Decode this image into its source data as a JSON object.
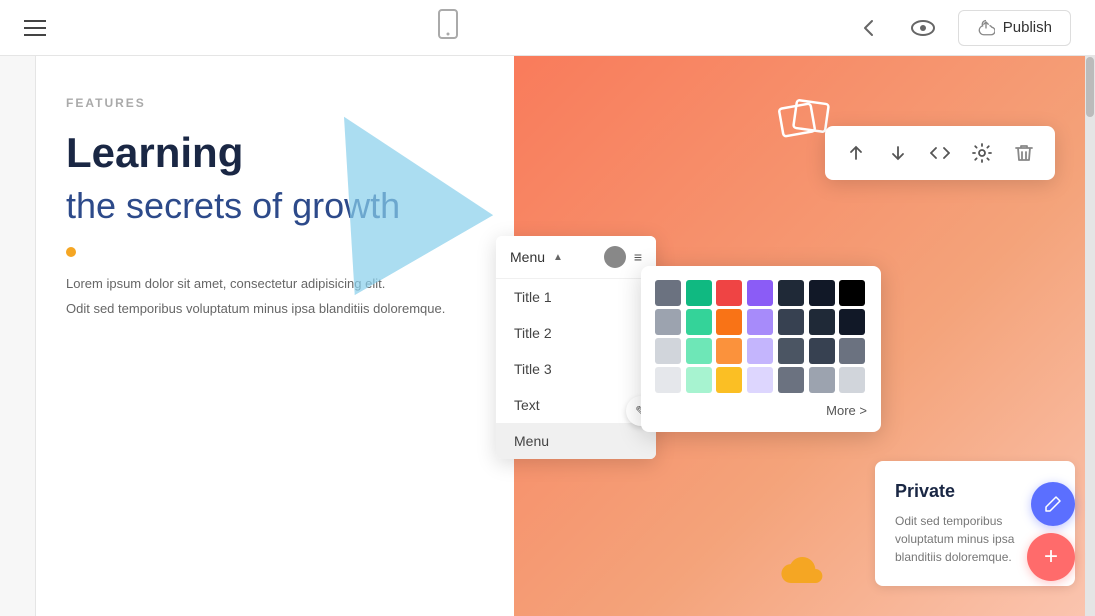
{
  "topbar": {
    "menu_label": "Menu",
    "back_label": "←",
    "eye_label": "👁",
    "publish_label": "Publish",
    "upload_icon": "⬆"
  },
  "toolbar": {
    "move_up": "↑",
    "move_down": "↓",
    "code": "</>",
    "settings": "⚙",
    "delete": "🗑"
  },
  "dropdown": {
    "menu_label": "Menu",
    "chevron": "▲",
    "items": [
      {
        "label": "Title 1"
      },
      {
        "label": "Title 2"
      },
      {
        "label": "Title 3"
      },
      {
        "label": "Text"
      },
      {
        "label": "Menu"
      }
    ]
  },
  "color_picker": {
    "colors": [
      "#6b7280",
      "#10b981",
      "#ef4444",
      "#8b5cf6",
      "#1f2937",
      "#111827",
      "#000000",
      "#9ca3af",
      "#34d399",
      "#f97316",
      "#a78bfa",
      "#374151",
      "#1f2937",
      "#111827",
      "#d1d5db",
      "#6ee7b7",
      "#fb923c",
      "#c4b5fd",
      "#4b5563",
      "#374151",
      "#6b7280",
      "#e5e7eb",
      "#a7f3d0",
      "#fbbf24",
      "#ddd6fe",
      "#6b7280",
      "#9ca3af",
      "#d1d5db"
    ],
    "more_label": "More >"
  },
  "page": {
    "features_label": "FEATURES",
    "headline": "Learning",
    "subheadline": "the secrets of growth",
    "orange_dot": true,
    "body_text_1": "Lorem ipsum dolor sit amet, consectetur adipisicing elit.",
    "body_text_2": "Odit sed temporibus voluptatum minus ipsa blanditiis doloremque."
  },
  "private_card": {
    "title": "Private",
    "text": "Odit sed temporibus voluptatum minus ipsa blanditiis doloremque."
  },
  "icons": {
    "hamburger": "≡",
    "mobile": "📱",
    "back": "←",
    "eye": "◉",
    "upload": "⬆",
    "pencil": "✎",
    "plus": "+",
    "cloud": "☁"
  }
}
